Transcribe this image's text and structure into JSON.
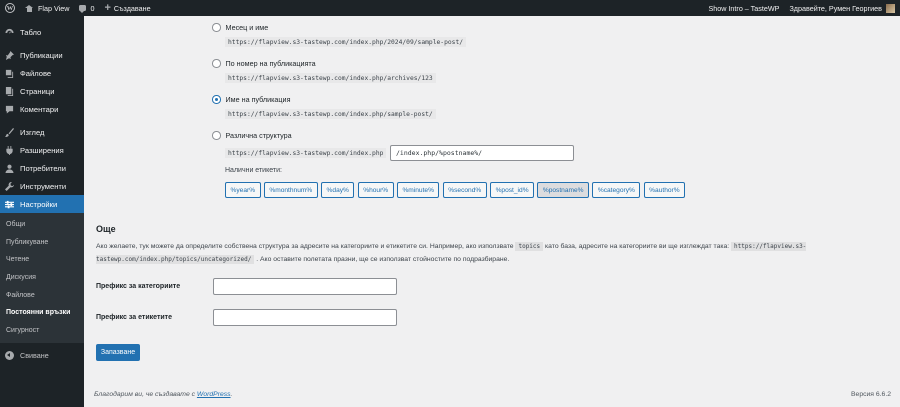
{
  "adminbar": {
    "site_name": "Flap View",
    "comments_count": "0",
    "new_label": "Създаване",
    "show_intro": "Show Intro – TasteWP",
    "greeting": "Здравейте, Румен Георгиев"
  },
  "sidebar": {
    "items": [
      {
        "label": "Табло",
        "icon": "dashboard-icon"
      },
      {
        "label": "Публикации",
        "icon": "pin-icon"
      },
      {
        "label": "Файлове",
        "icon": "media-icon"
      },
      {
        "label": "Страници",
        "icon": "page-icon"
      },
      {
        "label": "Коментари",
        "icon": "comment-icon"
      },
      {
        "label": "Изглед",
        "icon": "brush-icon"
      },
      {
        "label": "Разширения",
        "icon": "plugin-icon"
      },
      {
        "label": "Потребители",
        "icon": "users-icon"
      },
      {
        "label": "Инструменти",
        "icon": "wrench-icon"
      },
      {
        "label": "Настройки",
        "icon": "settings-icon"
      }
    ],
    "submenu": [
      "Общи",
      "Публикуване",
      "Четене",
      "Дискусия",
      "Файлове",
      "Постоянни връзки",
      "Сигурност"
    ],
    "collapse_label": "Свиване"
  },
  "permalinks": {
    "options": [
      {
        "label": "Месец и име",
        "example": "https://flapview.s3-tastewp.com/index.php/2024/09/sample-post/",
        "checked": false
      },
      {
        "label": "По номер на публикацията",
        "example": "https://flapview.s3-tastewp.com/index.php/archives/123",
        "checked": false
      },
      {
        "label": "Име на публикация",
        "example": "https://flapview.s3-tastewp.com/index.php/sample-post/",
        "checked": true
      },
      {
        "label": "Различна структура",
        "example": "https://flapview.s3-tastewp.com/index.php",
        "checked": false
      }
    ],
    "custom_value": "/index.php/%postname%/",
    "tags_label": "Налични етикети:",
    "tags": [
      "%year%",
      "%monthnum%",
      "%day%",
      "%hour%",
      "%minute%",
      "%second%",
      "%post_id%",
      "%postname%",
      "%category%",
      "%author%"
    ],
    "active_tag": "%postname%"
  },
  "optional": {
    "title": "Още",
    "desc_1": "Ако желаете, тук можете да определите собствена структура за адресите на категориите и етикетите си. Например, ако използвате",
    "desc_code_1": "topics",
    "desc_2": "като база, адресите на категориите ви ще изглеждат така:",
    "desc_code_2": "https://flapview.s3-tastewp.com/index.php/topics/uncategorized/",
    "desc_3": ". Ако оставите полетата празни, ще се използват стойностите по подразбиране.",
    "category_label": "Префикс за категориите",
    "category_value": "",
    "tag_label": "Префикс за етикетите",
    "tag_value": ""
  },
  "save_label": "Запазване",
  "footer": {
    "thanks": "Благодарим ви, че създавате с",
    "link": "WordPress",
    "version": "Версия 6.6.2"
  },
  "colors": {
    "accent": "#2271b1",
    "sidebar": "#1d2327",
    "background": "#f0f0f1"
  }
}
